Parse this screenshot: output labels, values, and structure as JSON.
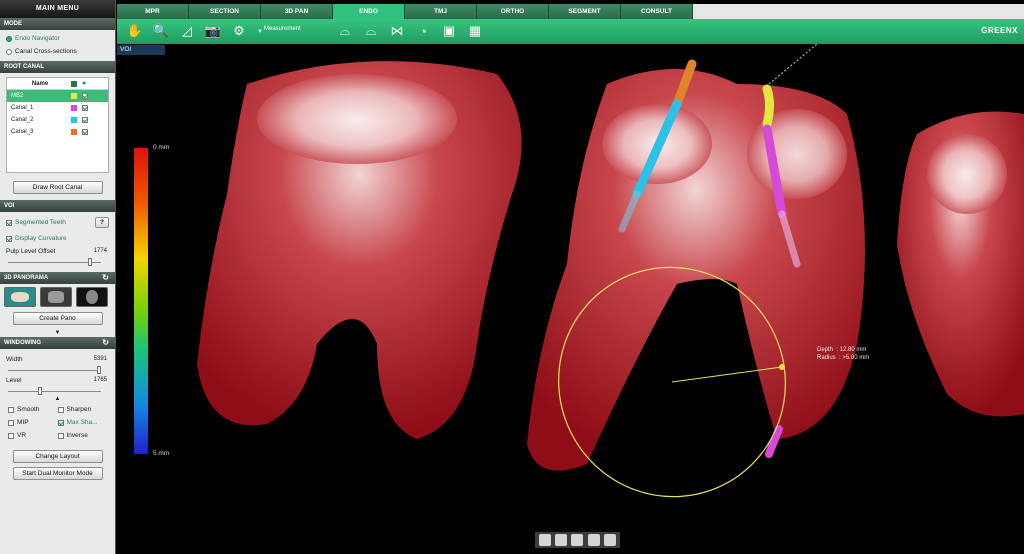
{
  "left_panel": {
    "title": "MAIN MENU",
    "mode": {
      "header": "MODE",
      "options": [
        {
          "label": "Endo Navigator",
          "selected": true
        },
        {
          "label": "Canal Cross-sections",
          "selected": false
        }
      ]
    },
    "root_canal": {
      "header": "ROOT CANAL",
      "col_name": "Name",
      "rows": [
        {
          "name": "MB2",
          "color": "#e8e84a",
          "visible": true,
          "selected": true
        },
        {
          "name": "Canal_1",
          "color": "#e040e0",
          "visible": true,
          "selected": false
        },
        {
          "name": "Canal_2",
          "color": "#20c8e8",
          "visible": true,
          "selected": false
        },
        {
          "name": "Canal_3",
          "color": "#f07020",
          "visible": true,
          "selected": false
        }
      ],
      "draw_button": "Draw Root Canal"
    },
    "voi": {
      "header": "VOI",
      "segmented_teeth": "Segmented Teeth",
      "help_button": "?",
      "display_curvature": "Display Curvature",
      "pulp_label": "Pulp Level Offset",
      "pulp_value": "1774"
    },
    "panorama": {
      "header": "3D PANORAMA",
      "create_button": "Create Pano"
    },
    "windowing": {
      "header": "WINDOWING",
      "width_label": "Width",
      "width_value": "5391",
      "level_label": "Level",
      "level_value": "1765",
      "options": [
        {
          "label": "Smooth",
          "checked": false
        },
        {
          "label": "Sharpen",
          "checked": false
        },
        {
          "label": "MIP",
          "checked": false
        },
        {
          "label": "Max Sha...",
          "checked": true
        },
        {
          "label": "VR",
          "checked": false
        },
        {
          "label": "Inverse",
          "checked": false
        }
      ],
      "change_layout": "Change Layout",
      "dual_monitor": "Start Dual Monitor Mode"
    }
  },
  "tabs": [
    {
      "label": "MPR",
      "active": false
    },
    {
      "label": "SECTION",
      "active": false
    },
    {
      "label": "3D PAN",
      "active": false
    },
    {
      "label": "ENDO",
      "active": true
    },
    {
      "label": "TMJ",
      "active": false
    },
    {
      "label": "ORTHO",
      "active": false
    },
    {
      "label": "SEGMENT",
      "active": false
    },
    {
      "label": "CONSULT",
      "active": false
    }
  ],
  "toolbar": {
    "measurement": "Measurement",
    "brand": "GREENX"
  },
  "viewport": {
    "voi_label": "VOI",
    "colorbar_top": "0 mm",
    "colorbar_bottom": "5 mm",
    "readout": "Depth  : 12.80 mm\nRadius  : >5.00 mm"
  }
}
